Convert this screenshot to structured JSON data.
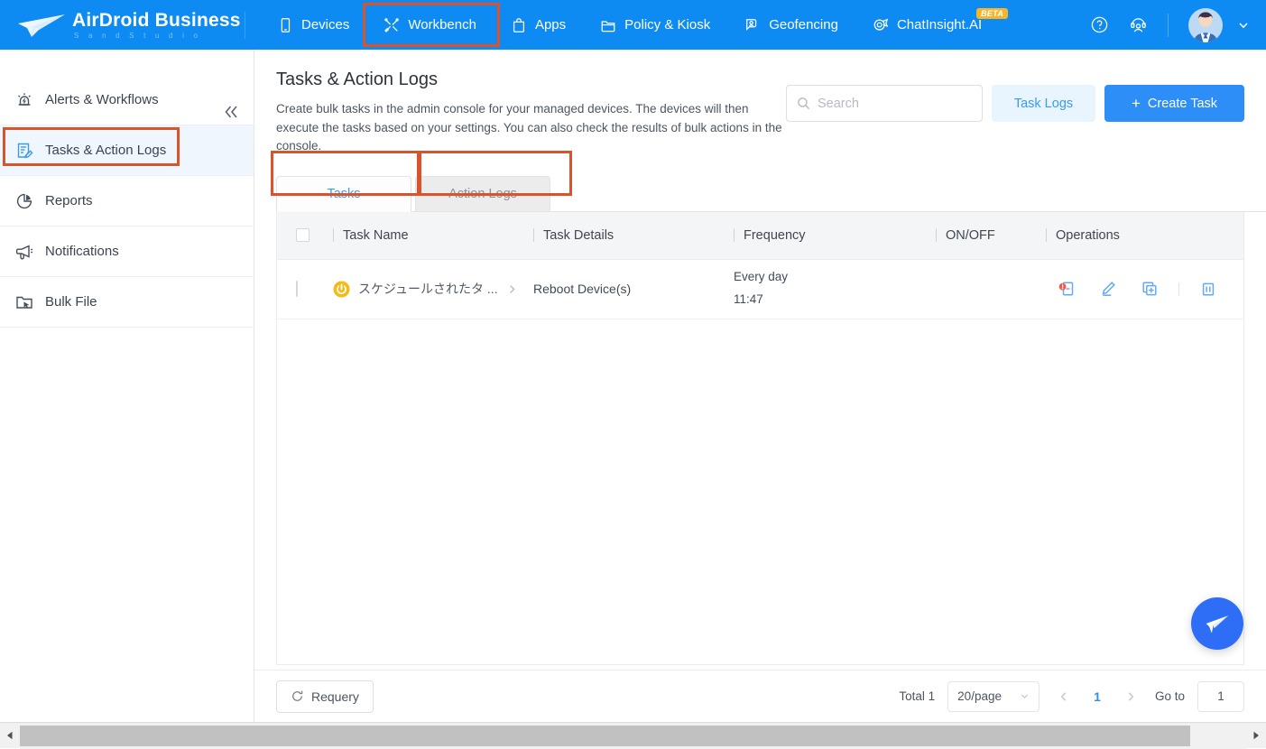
{
  "brand": {
    "name": "AirDroid Business",
    "sub": "S a n d   S t u d i o",
    "logo_icon": "paper-plane-icon"
  },
  "topnav": {
    "items": [
      {
        "label": "Devices",
        "icon": "tablet-icon",
        "active": false
      },
      {
        "label": "Workbench",
        "icon": "tools-icon",
        "active": true
      },
      {
        "label": "Apps",
        "icon": "app-bag-icon",
        "active": false
      },
      {
        "label": "Policy & Kiosk",
        "icon": "folder-icon",
        "active": false
      },
      {
        "label": "Geofencing",
        "icon": "map-pin-icon",
        "active": false
      },
      {
        "label": "ChatInsight.AI",
        "icon": "chat-target-icon",
        "active": false,
        "badge": "BETA"
      }
    ],
    "right_icons": [
      "help-circle-icon",
      "support-agent-icon"
    ],
    "avatar": "user-avatar",
    "caret": "chevron-down-icon"
  },
  "sidebar": {
    "collapse_icon": "double-chevron-left-icon",
    "items": [
      {
        "label": "Alerts & Workflows",
        "icon": "alarm-icon",
        "selected": false
      },
      {
        "label": "Tasks & Action Logs",
        "icon": "task-edit-icon",
        "selected": true
      },
      {
        "label": "Reports",
        "icon": "pie-chart-icon",
        "selected": false
      },
      {
        "label": "Notifications",
        "icon": "megaphone-icon",
        "selected": false
      },
      {
        "label": "Bulk File",
        "icon": "folder-cursor-icon",
        "selected": false
      }
    ]
  },
  "page": {
    "title": "Tasks & Action Logs",
    "description": "Create bulk tasks in the admin console for your managed devices. The devices will then execute the tasks based on your settings. You can also check the results of bulk actions in the console."
  },
  "search": {
    "placeholder": "Search",
    "value": "",
    "icon": "search-icon"
  },
  "actions": {
    "task_logs_label": "Task Logs",
    "create_task_label": "Create Task",
    "create_task_plus": "+"
  },
  "tabs": [
    {
      "label": "Tasks",
      "active": true
    },
    {
      "label": "Action Logs",
      "active": false
    }
  ],
  "table": {
    "columns": [
      "Task Name",
      "Task Details",
      "Frequency",
      "ON/OFF",
      "Operations"
    ],
    "rows": [
      {
        "task_name": "スケジュールされたタ ...",
        "task_name_icon": "power-icon",
        "expand_icon": "chevron-right-icon",
        "task_details": "Reboot Device(s)",
        "frequency_line1": "Every day",
        "frequency_line2": "11:47",
        "on_off": "on",
        "operations": [
          {
            "name": "notify-device-icon"
          },
          {
            "name": "edit-pencil-icon"
          },
          {
            "name": "copy-add-icon"
          },
          {
            "name": "delete-trash-icon"
          }
        ]
      }
    ]
  },
  "footer": {
    "requery_label": "Requery",
    "requery_icon": "refresh-icon",
    "total_label": "Total 1",
    "page_size": "20/page",
    "page_size_caret": "chevron-down-icon",
    "prev_icon": "chevron-left-icon",
    "current_page": "1",
    "next_icon": "chevron-right-icon",
    "goto_label": "Go to",
    "goto_value": "1"
  },
  "fab": {
    "icon": "paper-plane-icon"
  },
  "colors": {
    "brand_blue": "#0d8bf2",
    "accent_blue": "#2e8ef7",
    "highlight_orange": "#d9542b",
    "toggle_on": "#2e8ef7",
    "badge_yellow": "#f7b52c",
    "task_icon_yellow": "#f5b919"
  },
  "scrollbar": {
    "left_icon": "triangle-left-icon",
    "right_icon": "triangle-right-icon"
  }
}
